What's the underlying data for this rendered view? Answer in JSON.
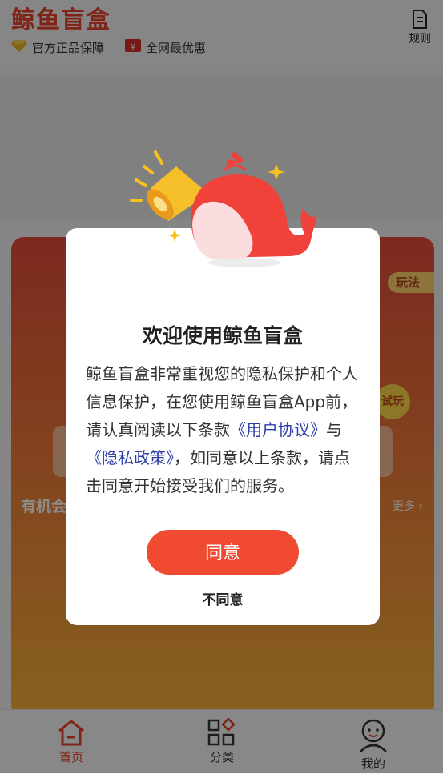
{
  "header": {
    "title": "鲸鱼盲盒",
    "badges": [
      {
        "label": "官方正品保障",
        "icon": "diamond-icon"
      },
      {
        "label": "全网最优惠",
        "icon": "ticket-icon"
      }
    ],
    "rules_label": "规则"
  },
  "card": {
    "play_label": "玩法",
    "try_label": "试玩",
    "chance_text": "有机会",
    "more_label": "更多 ›"
  },
  "dialog": {
    "title": "欢迎使用鲸鱼盲盒",
    "body_part1": "鲸鱼盲盒非常重视您的隐私保护和个人信息保护，在您使用鲸鱼盲盒App前，请认真阅读以下条款",
    "link_user_agreement": "《用户协议》",
    "body_and": "与",
    "link_privacy_policy": "《隐私政策》",
    "body_part2": "，如同意以上条款，请点击同意开始接受我们的服务。",
    "agree_label": "同意",
    "disagree_label": "不同意"
  },
  "tabbar": {
    "items": [
      {
        "label": "首页",
        "icon": "home-icon",
        "active": true
      },
      {
        "label": "分类",
        "icon": "category-icon",
        "active": false
      },
      {
        "label": "我的",
        "icon": "profile-icon",
        "active": false
      }
    ]
  },
  "colors": {
    "brand": "#e8422a",
    "agree_button": "#f14a32",
    "link": "#2d3ea8"
  }
}
